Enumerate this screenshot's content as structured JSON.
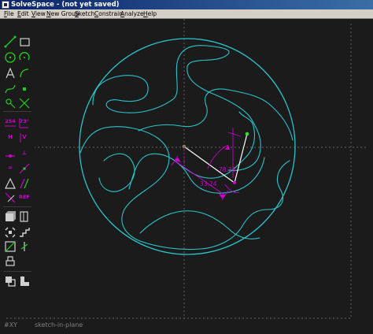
{
  "window": {
    "title": "SolveSpace - (not yet saved)"
  },
  "menu": [
    {
      "label": "File"
    },
    {
      "label": "Edit"
    },
    {
      "label": "View"
    },
    {
      "label": "New Group"
    },
    {
      "label": "Sketch"
    },
    {
      "label": "Constrain"
    },
    {
      "label": "Analyze"
    },
    {
      "label": "Help"
    }
  ],
  "toolbar": {
    "line_segment": "line-segment-icon",
    "rectangle": "rectangle-icon",
    "circle": "circle-icon",
    "arc": "arc-icon",
    "text": "text-icon",
    "tangent_arc": "tangent-arc-icon",
    "cubic_spline": "cubic-spline-icon",
    "datum_point": "datum-point-icon",
    "workplane": "workplane-icon",
    "trim": "split-curves-icon",
    "distance_label": "254",
    "angle_label": "73°",
    "horizontal_label": "H",
    "vertical_label": "V",
    "on_point": "on-entity-icon",
    "equal_label": "=",
    "symmetric_label": "⊥",
    "midpoint": "midpoint-icon",
    "parallel": "parallel-icon",
    "point_on_line": "tangent-icon",
    "same_orientation": "same-orientation-icon",
    "reference_label": "REF",
    "new_step": "extrude-icon",
    "lathe": "lathe-icon",
    "sweep": "sweep-icon",
    "helix": "helix-icon",
    "in_workplane": "workplane-group-icon",
    "translate": "translate-icon",
    "rotate": "rotate-icon",
    "import": "import-icon",
    "assemble": "assemble-icon",
    "step": "step-icon"
  },
  "dimensions": {
    "length": "33.24",
    "angle": "78.35"
  },
  "status": {
    "view": "#XY",
    "mode": "sketch-in-plane"
  },
  "colors": {
    "sketch": "#2cc4cc",
    "constraint": "#cc00cc",
    "selected": "#ffffff",
    "point": "#33dd33",
    "tool_icon": "#22cc22",
    "tool_label": "#cc00cc",
    "background": "#1b1b1b"
  }
}
